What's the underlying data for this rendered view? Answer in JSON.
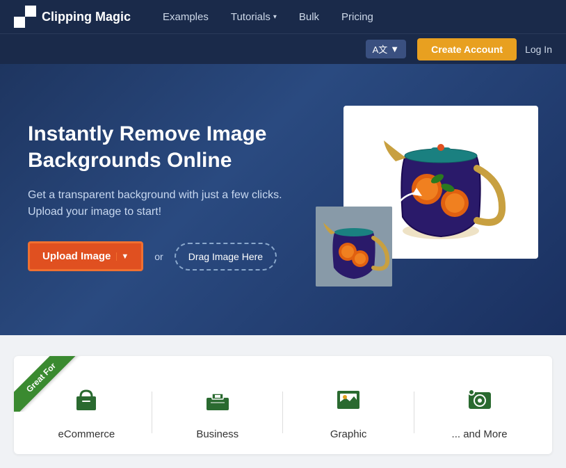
{
  "navbar": {
    "brand": "Clipping Magic",
    "links": [
      {
        "label": "Examples",
        "hasDropdown": false
      },
      {
        "label": "Tutorials",
        "hasDropdown": true
      },
      {
        "label": "Bulk",
        "hasDropdown": false
      },
      {
        "label": "Pricing",
        "hasDropdown": false
      }
    ]
  },
  "navbar_row2": {
    "lang_label": "A文",
    "lang_arrow": "▼",
    "create_account": "Create Account",
    "login": "Log In"
  },
  "hero": {
    "title": "Instantly Remove Image Backgrounds Online",
    "subtitle": "Get a transparent background with just a few clicks. Upload your image to start!",
    "upload_btn": "Upload Image",
    "upload_arrow": "▼",
    "or_text": "or",
    "drag_btn": "Drag Image Here"
  },
  "features": {
    "badge": "Great For",
    "items": [
      {
        "label": "eCommerce",
        "icon": "🛒"
      },
      {
        "label": "Business",
        "icon": "💼"
      },
      {
        "label": "Graphic",
        "icon": "🖼️"
      },
      {
        "label": "... and More",
        "icon": "📷"
      }
    ]
  }
}
